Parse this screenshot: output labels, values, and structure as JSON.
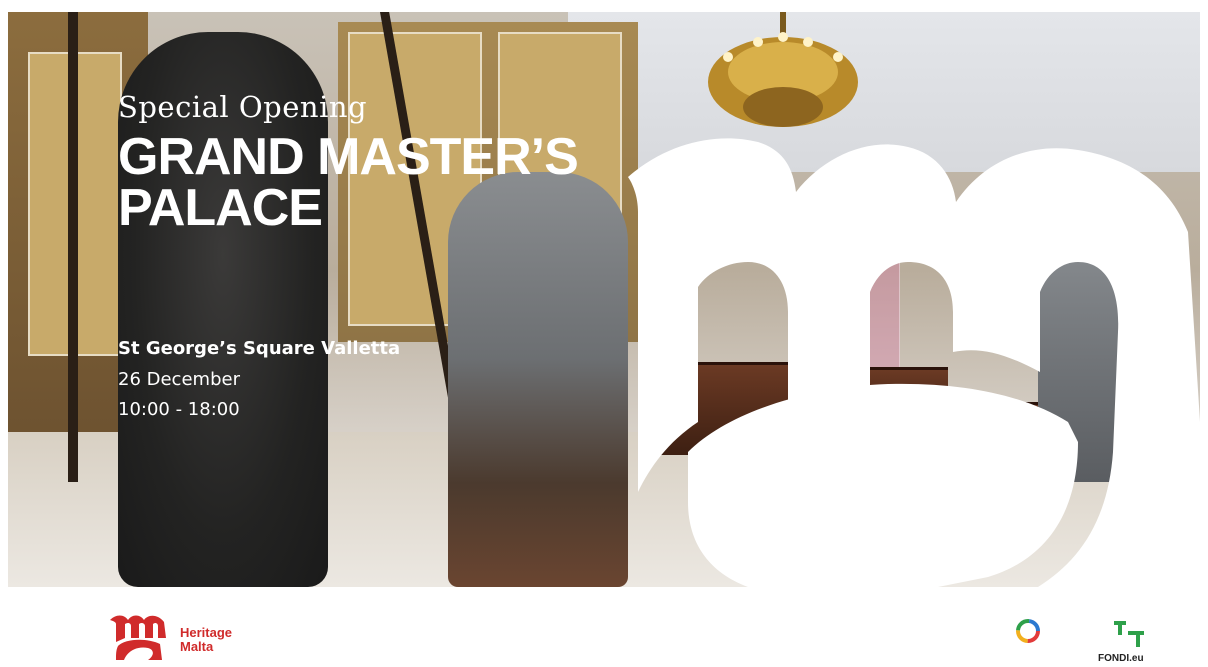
{
  "poster": {
    "subtitle": "Special Opening",
    "title_line1": "GRAND MASTER’S",
    "title_line2": "PALACE",
    "location": "St George’s Square Valletta",
    "date": "26 December",
    "time": "10:00 - 18:00"
  },
  "footer": {
    "heritage_logo_line1": "Heritage",
    "heritage_logo_line2": "Malta",
    "fondi_logo": "FONDI.eu"
  },
  "colors": {
    "brand_red": "#d02b2b",
    "fondi_green": "#2ea04a",
    "white": "#ffffff"
  },
  "icons": [
    "heritage-malta-logo-icon",
    "colorful-ring-logo-icon",
    "fondi-logo-icon"
  ]
}
